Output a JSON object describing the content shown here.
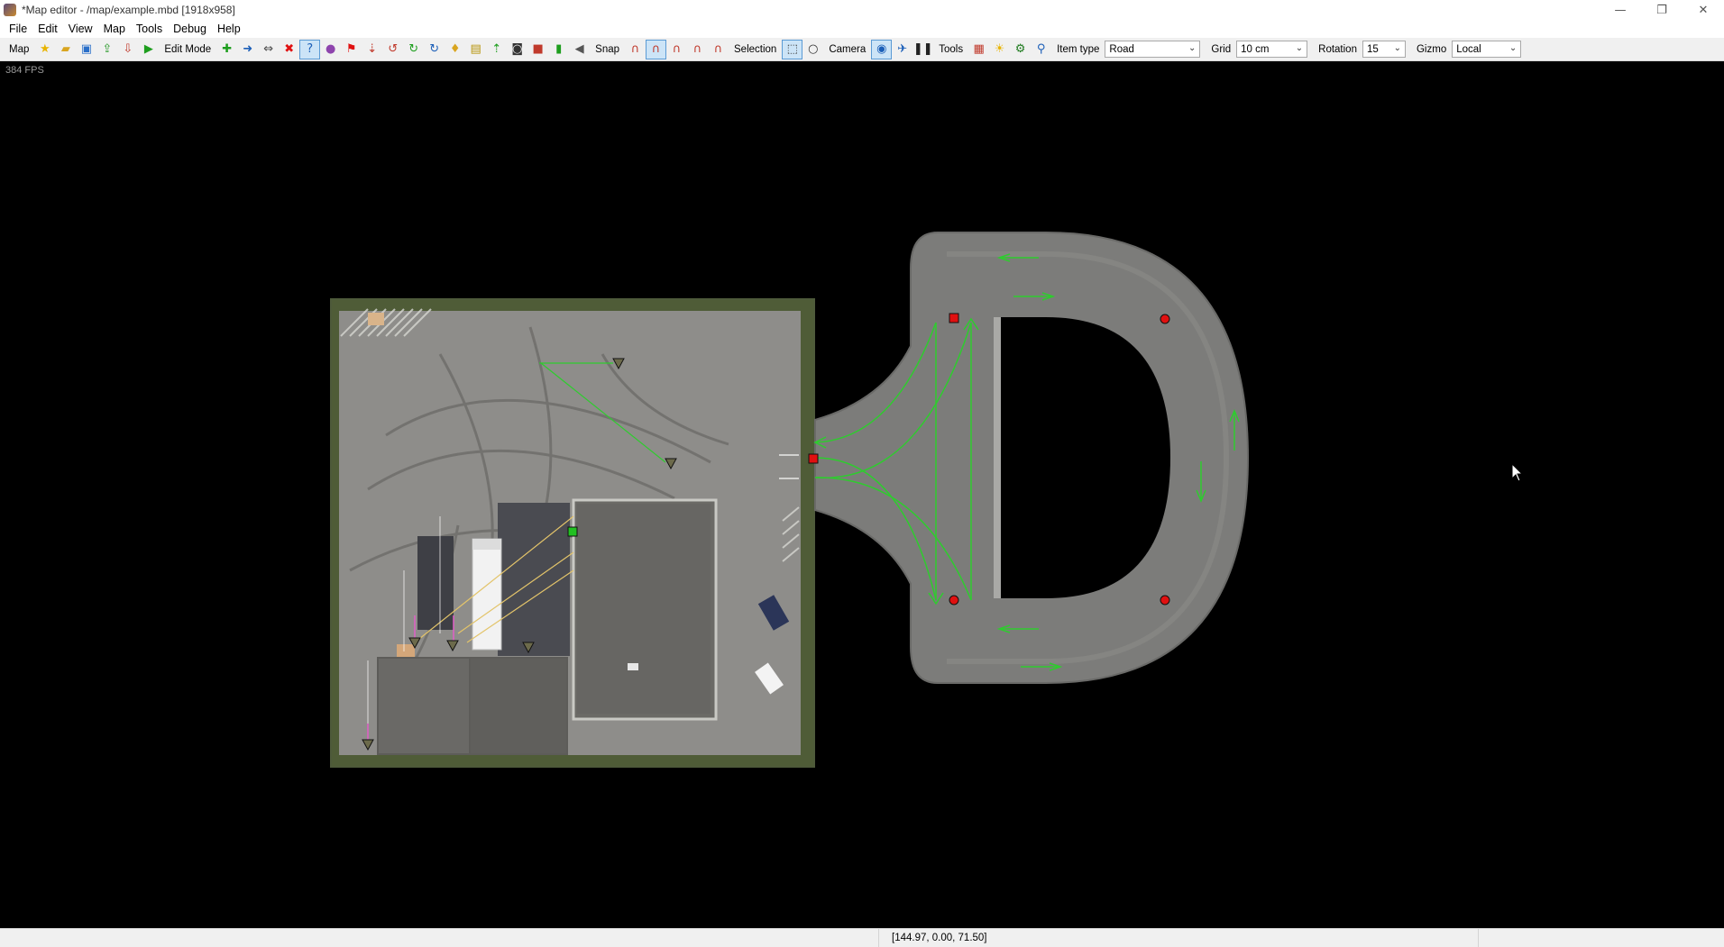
{
  "window": {
    "title": "*Map editor - /map/example.mbd [1918x958]",
    "controls": {
      "minimize": "—",
      "restore": "❐",
      "close": "✕"
    }
  },
  "menu": [
    "File",
    "Edit",
    "View",
    "Map",
    "Tools",
    "Debug",
    "Help"
  ],
  "toolbar": {
    "map_label": "Map",
    "edit_mode_label": "Edit Mode",
    "snap_label": "Snap",
    "selection_label": "Selection",
    "camera_label": "Camera",
    "tools_label": "Tools",
    "item_type_label": "Item type",
    "item_type_value": "Road",
    "grid_label": "Grid",
    "grid_value": "10 cm",
    "rotation_label": "Rotation",
    "rotation_value": "15",
    "gizmo_label": "Gizmo",
    "gizmo_value": "Local"
  },
  "viewport": {
    "fps": "384 FPS"
  },
  "status": {
    "coords": "[144.97, 0.00, 71.50]"
  },
  "colors": {
    "road_arrow": "#2ecc2e",
    "node_red": "#e01010",
    "node_green": "#22c022",
    "viewport_bg": "#000000"
  }
}
